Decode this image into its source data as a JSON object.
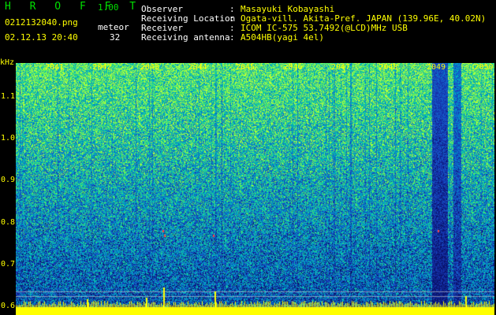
{
  "app": {
    "brand": "H R O F F T",
    "version": "1.00",
    "filename": "0212132040.png",
    "datetime": "02.12.13 20:40",
    "mode_label": "meteor",
    "count": "32"
  },
  "info": [
    {
      "label": "Observer",
      "value": "Masayuki Kobayashi"
    },
    {
      "label": "Receiving Location",
      "value": "Ogata-vill. Akita-Pref. JAPAN (139.96E, 40.02N)"
    },
    {
      "label": "Receiver",
      "value": "ICOM IC-575 53.7492(@LCD)MHz USB"
    },
    {
      "label": "Receiving antenna",
      "value": "A504HB(yagi 4el)"
    }
  ],
  "colors": {
    "background": "#000000",
    "label_text": "#ffff00",
    "header_white": "#ffffff",
    "brand_green": "#00e000",
    "spectrum_low": "#0a1a7a",
    "spectrum_mid": "#00a0c0",
    "spectrum_high": "#60ff60",
    "baseline_yellow": "#ffff00"
  },
  "chart_data": {
    "type": "heatmap",
    "ylabel": "kHz",
    "y_ticks": [
      "1.1",
      "1.0",
      "0.9",
      "0.8",
      "0.7",
      "0.6"
    ],
    "x_ticks": [
      "2041",
      "2042",
      "2043",
      "2044",
      "2045",
      "2046",
      "2047",
      "2048",
      "2049",
      "2050"
    ],
    "ylim": [
      0.58,
      1.18
    ]
  }
}
